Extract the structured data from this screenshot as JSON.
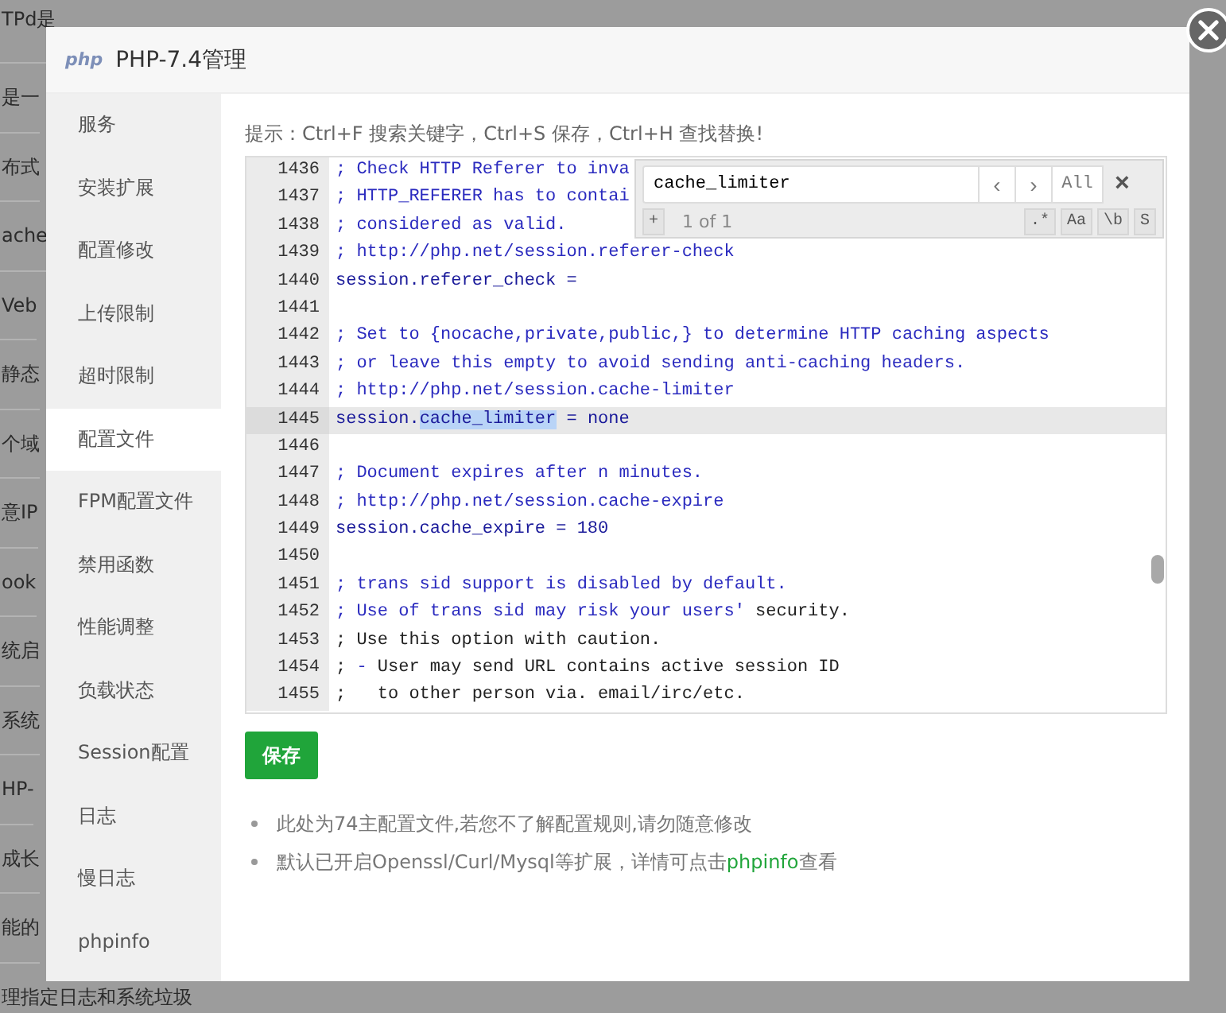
{
  "background_rows": [
    "TPd是",
    "是一",
    "布式",
    "ache",
    "Veb",
    "静态",
    "个域",
    "意IP",
    "ook",
    "统启",
    "系统",
    "HP-",
    "成长",
    "能的",
    "理指定日志和系统垃圾"
  ],
  "dialog": {
    "title": "PHP-7.4管理",
    "logo": "php"
  },
  "sidebar": {
    "items": [
      {
        "label": "服务",
        "selected": false
      },
      {
        "label": "安装扩展",
        "selected": false
      },
      {
        "label": "配置修改",
        "selected": false
      },
      {
        "label": "上传限制",
        "selected": false
      },
      {
        "label": "超时限制",
        "selected": false
      },
      {
        "label": "配置文件",
        "selected": true
      },
      {
        "label": "FPM配置文件",
        "selected": false
      },
      {
        "label": "禁用函数",
        "selected": false
      },
      {
        "label": "性能调整",
        "selected": false
      },
      {
        "label": "负载状态",
        "selected": false
      },
      {
        "label": "Session配置",
        "selected": false
      },
      {
        "label": "日志",
        "selected": false
      },
      {
        "label": "慢日志",
        "selected": false
      },
      {
        "label": "phpinfo",
        "selected": false
      }
    ]
  },
  "hint": "提示：Ctrl+F 搜索关键字，Ctrl+S 保存，Ctrl+H 查找替换!",
  "editor": {
    "lines": [
      {
        "number": "1436",
        "active": false,
        "segments": [
          {
            "kind": "comment",
            "text": "; Check HTTP Referer to inva"
          }
        ]
      },
      {
        "number": "1437",
        "active": false,
        "segments": [
          {
            "kind": "comment",
            "text": "; HTTP_REFERER has to contai"
          }
        ]
      },
      {
        "number": "1438",
        "active": false,
        "segments": [
          {
            "kind": "comment",
            "text": "; considered as valid."
          }
        ]
      },
      {
        "number": "1439",
        "active": false,
        "segments": [
          {
            "kind": "comment",
            "text": "; http://php.net/session.referer-check"
          }
        ]
      },
      {
        "number": "1440",
        "active": false,
        "segments": [
          {
            "kind": "key",
            "text": "session.referer_check ="
          }
        ]
      },
      {
        "number": "1441",
        "active": false
      },
      {
        "number": "1442",
        "active": false,
        "segments": [
          {
            "kind": "comment",
            "text": "; Set to {nocache,private,public,} to determine HTTP caching aspects"
          }
        ]
      },
      {
        "number": "1443",
        "active": false,
        "segments": [
          {
            "kind": "comment",
            "text": "; or leave this empty to avoid sending anti-caching headers."
          }
        ]
      },
      {
        "number": "1444",
        "active": false,
        "segments": [
          {
            "kind": "comment",
            "text": "; http://php.net/session.cache-limiter"
          }
        ]
      },
      {
        "number": "1445",
        "active": true,
        "segments": [
          {
            "kind": "key",
            "text": "session."
          },
          {
            "kind": "match",
            "text": "cache_limiter"
          },
          {
            "kind": "key",
            "text": " = none"
          }
        ]
      },
      {
        "number": "1446",
        "active": false
      },
      {
        "number": "1447",
        "active": false,
        "segments": [
          {
            "kind": "comment",
            "text": "; Document expires after n minutes."
          }
        ]
      },
      {
        "number": "1448",
        "active": false,
        "segments": [
          {
            "kind": "comment",
            "text": "; http://php.net/session.cache-expire"
          }
        ]
      },
      {
        "number": "1449",
        "active": false,
        "segments": [
          {
            "kind": "key",
            "text": "session.cache_expire = 180"
          }
        ]
      },
      {
        "number": "1450",
        "active": false
      },
      {
        "number": "1451",
        "active": false,
        "segments": [
          {
            "kind": "comment",
            "text": "; trans sid support is disabled by default."
          }
        ]
      },
      {
        "number": "1452",
        "active": false,
        "segments": [
          {
            "kind": "comment",
            "text": "; Use of trans sid may risk your users'"
          },
          {
            "kind": "plain",
            "text": " security."
          }
        ]
      },
      {
        "number": "1453",
        "active": false,
        "segments": [
          {
            "kind": "plain",
            "text": "; Use this option with caution."
          }
        ]
      },
      {
        "number": "1454",
        "active": false,
        "segments": [
          {
            "kind": "plain",
            "text": "; "
          },
          {
            "kind": "comment",
            "text": "-"
          },
          {
            "kind": "plain",
            "text": " User may send URL contains active session ID"
          }
        ]
      },
      {
        "number": "1455",
        "active": false,
        "segments": [
          {
            "kind": "plain",
            "text": ";   to other person via. email/irc/etc."
          }
        ]
      }
    ],
    "search": {
      "value": "cache_limiter",
      "prev": "‹",
      "next": "›",
      "all": "All",
      "close": "×",
      "add": "+",
      "count": "1 of 1",
      "options": [
        ".*",
        "Aa",
        "\\b",
        "S"
      ]
    }
  },
  "save_button": "保存",
  "notes": [
    {
      "text": "此处为74主配置文件,若您不了解配置规则,请勿随意修改"
    },
    {
      "text": "默认已开启Openssl/Curl/Mysql等扩展，详情可点击",
      "link": "phpinfo",
      "after": "查看"
    }
  ]
}
